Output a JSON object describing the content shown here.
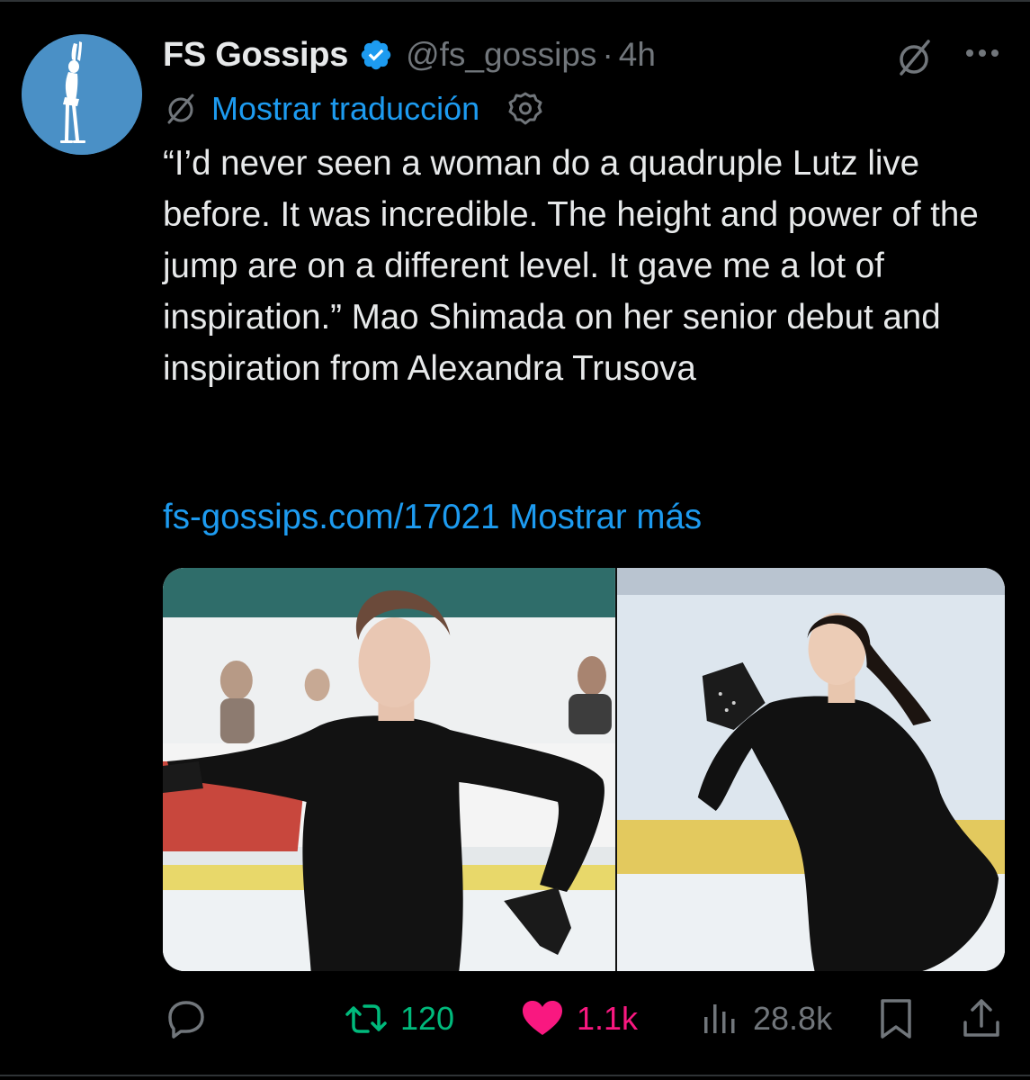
{
  "author": {
    "display_name": "FS Gossips",
    "handle": "@fs_gossips",
    "separator": "·",
    "time": "4h",
    "verified": true,
    "avatar_icon": "figure-skater-silhouette"
  },
  "translate": {
    "label": "Mostrar traducción",
    "icon": "grok-icon"
  },
  "tweet": {
    "text": "“I’d never seen a woman do a quadruple Lutz live before. It was incredible. The height and power of the jump are on a different level. It gave me a lot of inspiration.” Mao Shimada on her senior debut and inspiration from Alexandra Trusova",
    "link": "fs-gossips.com/17021",
    "show_more": "Mostrar más"
  },
  "media": {
    "photos": [
      {
        "subject": "skater-left"
      },
      {
        "subject": "skater-right"
      }
    ]
  },
  "actions": {
    "reply": {
      "icon": "reply-icon",
      "count": ""
    },
    "retweet": {
      "icon": "retweet-icon",
      "count": "120"
    },
    "like": {
      "icon": "heart-icon",
      "count": "1.1k",
      "liked": true
    },
    "views": {
      "icon": "views-icon",
      "count": "28.8k"
    },
    "bookmark": {
      "icon": "bookmark-icon"
    },
    "share": {
      "icon": "share-icon"
    }
  },
  "colors": {
    "background": "#000000",
    "text": "#e7e9ea",
    "muted": "#71767b",
    "link": "#1d9bf0",
    "retweet": "#00ba7c",
    "like": "#f91880",
    "avatar_bg": "#4a90c6"
  }
}
